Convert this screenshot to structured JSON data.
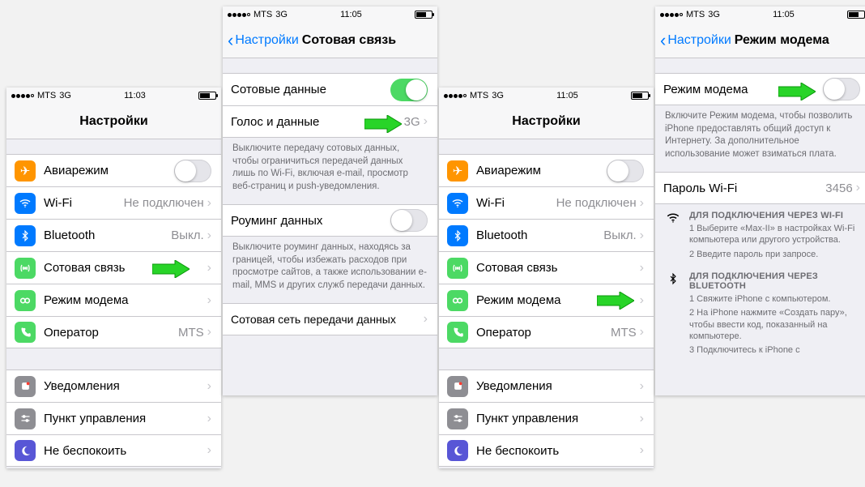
{
  "status": {
    "carrier": "MTS",
    "network": "3G",
    "time_a": "11:03",
    "time_b": "11:05"
  },
  "nav": {
    "settings_title": "Настройки",
    "back_settings": "Настройки",
    "cellular_title": "Сотовая связь",
    "hotspot_title": "Режим модема"
  },
  "s1": {
    "airplane": "Авиарежим",
    "wifi": "Wi-Fi",
    "wifi_detail": "Не подключен",
    "bluetooth": "Bluetooth",
    "bt_detail": "Выкл.",
    "cellular": "Сотовая связь",
    "hotspot": "Режим модема",
    "carrier": "Оператор",
    "carrier_detail": "MTS",
    "notifications": "Уведомления",
    "control": "Пункт управления",
    "dnd": "Не беспокоить"
  },
  "s2": {
    "cell_data": "Сотовые данные",
    "voice_data": "Голос и данные",
    "voice_detail": "3G",
    "footer1": "Выключите передачу сотовых данных, чтобы ограничиться передачей данных лишь по Wi-Fi, включая e-mail, просмотр веб-страниц и push-уведомления.",
    "roaming": "Роуминг данных",
    "footer2": "Выключите роуминг данных, находясь за границей, чтобы избежать расходов при просмотре сайтов, а также использовании e-mail, MMS и других служб передачи данных.",
    "apn": "Сотовая сеть передачи данных"
  },
  "s4": {
    "hotspot": "Режим модема",
    "footer": "Включите Режим модема, чтобы позволить iPhone предоставлять общий доступ к Интернету. За дополнительное использование может взиматься плата.",
    "wifi_pw_label": "Пароль Wi-Fi",
    "wifi_pw_value": "3456",
    "wifi_header": "ДЛЯ ПОДКЛЮЧЕНИЯ ЧЕРЕЗ WI-FI",
    "wifi_step1": "1 Выберите «Max-II» в настройках Wi-Fi компьютера или другого устройства.",
    "wifi_step2": "2 Введите пароль при запросе.",
    "bt_header": "ДЛЯ ПОДКЛЮЧЕНИЯ ЧЕРЕЗ BLUETOOTH",
    "bt_step1": "1 Свяжите iPhone с компьютером.",
    "bt_step2": "2 На iPhone нажмите «Создать пару», чтобы ввести код, показанный на компьютере.",
    "bt_step3": "3 Подключитесь к iPhone с"
  }
}
